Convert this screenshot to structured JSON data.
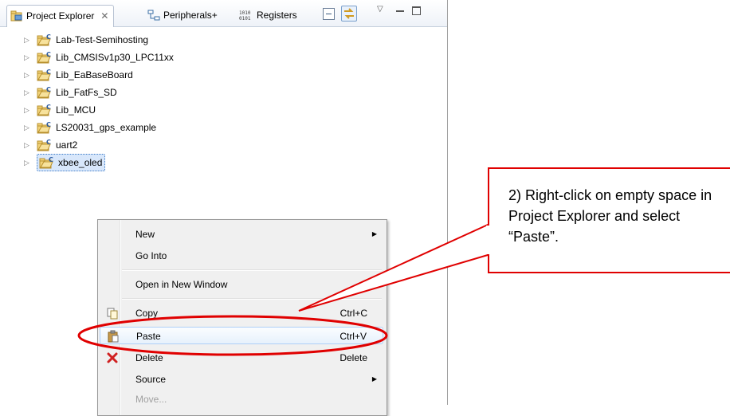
{
  "tabs": [
    {
      "label": "Project Explorer",
      "icon": "project-explorer-icon",
      "active": true
    },
    {
      "label": "Peripherals+",
      "icon": "peripherals-icon"
    },
    {
      "label": "Registers",
      "icon": "registers-icon"
    }
  ],
  "toolbar": {
    "icons": [
      "collapse-all-icon",
      "link-with-editor-icon",
      "view-menu-icon",
      "minimize-icon",
      "maximize-icon"
    ]
  },
  "projects": [
    {
      "label": "Lab-Test-Semihosting"
    },
    {
      "label": "Lib_CMSISv1p30_LPC11xx"
    },
    {
      "label": "Lib_EaBaseBoard"
    },
    {
      "label": "Lib_FatFs_SD"
    },
    {
      "label": "Lib_MCU"
    },
    {
      "label": "LS20031_gps_example"
    },
    {
      "label": "uart2"
    },
    {
      "label": "xbee_oled",
      "selected": true
    }
  ],
  "menu": {
    "items": [
      {
        "label": "New",
        "submenu": true
      },
      {
        "label": "Go Into"
      },
      {
        "label": "Open in New Window"
      },
      {
        "label": "Copy",
        "shortcut": "Ctrl+C",
        "icon": "copy-icon"
      },
      {
        "label": "Paste",
        "shortcut": "Ctrl+V",
        "icon": "paste-icon",
        "highlighted": true
      },
      {
        "label": "Delete",
        "shortcut": "Delete",
        "icon": "delete-icon"
      },
      {
        "label": "Source",
        "submenu": true
      },
      {
        "label": "Move...",
        "disabled": true
      }
    ]
  },
  "callout": {
    "text": "2) Right-click on empty space in Project Explorer and select “Paste”.",
    "color": "#e00000"
  },
  "colors": {
    "accent": "#e00000",
    "selection": "#d8e7fb"
  }
}
